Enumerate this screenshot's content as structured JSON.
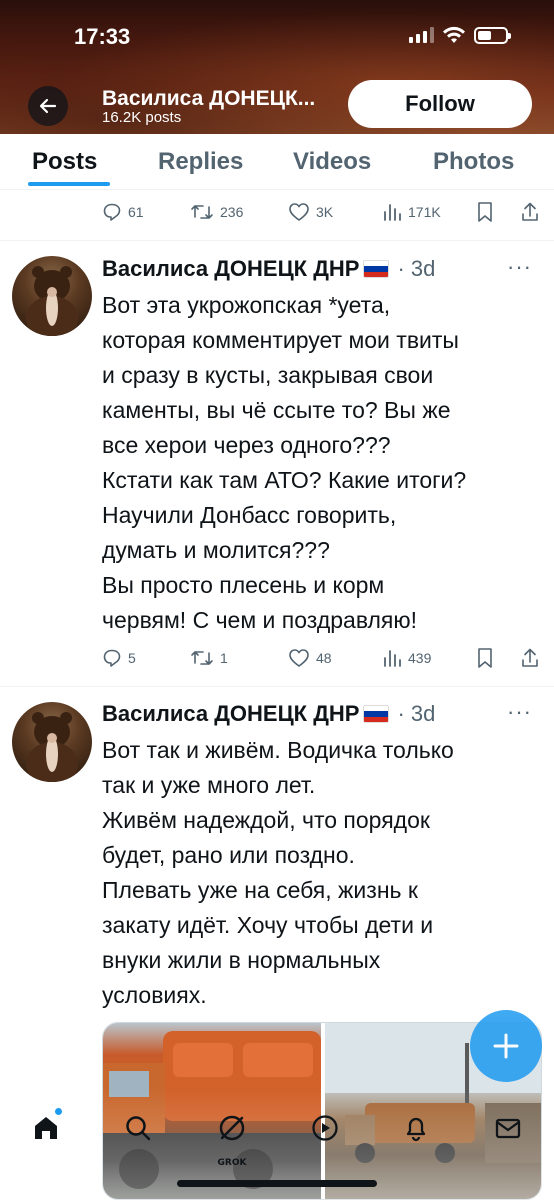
{
  "status_bar": {
    "time": "17:33"
  },
  "profile": {
    "name": "Василиса ДОНЕЦК...",
    "posts_count": "16.2K posts",
    "follow_label": "Follow"
  },
  "tabs": [
    {
      "label": "Posts",
      "active": true
    },
    {
      "label": "Replies",
      "active": false
    },
    {
      "label": "Videos",
      "active": false
    },
    {
      "label": "Photos",
      "active": false
    }
  ],
  "prev_tweet_stats": {
    "replies": "61",
    "reposts": "236",
    "likes": "3K",
    "views": "171K"
  },
  "tweets": [
    {
      "author": "Василиса ДОНЕЦК ДНР",
      "time": "3d",
      "more": "···",
      "text": "Вот эта укрожопская *уета,\nкоторая комментирует мои твиты\nи сразу в кусты, закрывая свои\nкаменты, вы чё ссыте то? Вы же\nвсе херои через одного???\nКстати как там АТО? Какие итоги?\nНаучили Донбасс говорить,\nдумать и молится???\nВы просто плесень и корм\nчервям! С чем и поздравляю!",
      "stats": {
        "replies": "5",
        "reposts": "1",
        "likes": "48",
        "views": "439"
      }
    },
    {
      "author": "Василиса ДОНЕЦК ДНР",
      "time": "3d",
      "more": "···",
      "text": "Вот так и живём. Водичка только\nтак и уже много лет.\nЖивём надеждой, что порядок\nбудет, рано или поздно.\nПлевать уже на себя, жизнь к\nзакату идёт. Хочу чтобы дети и\nвнуки жили в нормальных\nусловиях."
    }
  ],
  "bottom_nav": {
    "grok_label": "GROK"
  },
  "colors": {
    "accent": "#1d9bf0",
    "text": "#0f1419",
    "muted": "#536471",
    "divider": "#eff3f4"
  },
  "icons": [
    "back-arrow-icon",
    "reply-icon",
    "repost-icon",
    "like-icon",
    "views-icon",
    "bookmark-icon",
    "share-icon",
    "more-icon",
    "compose-plus-icon",
    "home-icon",
    "search-icon",
    "grok-icon",
    "play-icon",
    "bell-icon",
    "mail-icon"
  ]
}
